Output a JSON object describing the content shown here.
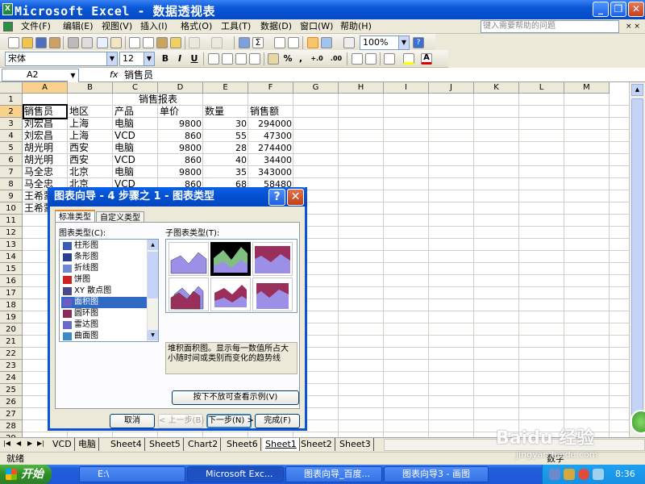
{
  "window": {
    "title": "Microsoft Excel - 数据透视表",
    "minimize": "_",
    "restore": "❐",
    "close": "✕"
  },
  "menu": {
    "items": [
      "文件(F)",
      "编辑(E)",
      "视图(V)",
      "插入(I)",
      "格式(O)",
      "工具(T)",
      "数据(D)",
      "窗口(W)",
      "帮助(H)"
    ],
    "help_placeholder": "键入需要帮助的问题",
    "doc_close": "× ×"
  },
  "toolbar": {
    "zoom": "100%",
    "font": "宋体",
    "font_size": "12",
    "bold": "B",
    "italic": "I",
    "underline": "U",
    "percent": "%",
    "comma": ",",
    "inc_decimal": "+.0",
    "dec_decimal": ".00"
  },
  "formula_bar": {
    "name_box": "A2",
    "fx": "fx",
    "content": "销售员"
  },
  "sheet": {
    "columns": [
      "A",
      "B",
      "C",
      "D",
      "E",
      "F",
      "G",
      "H",
      "I",
      "J",
      "K",
      "L",
      "M"
    ],
    "rows": [
      "1",
      "2",
      "3",
      "4",
      "5",
      "6",
      "7",
      "8",
      "9",
      "10",
      "11",
      "12",
      "13",
      "14",
      "15",
      "16",
      "17",
      "18",
      "19",
      "20",
      "21",
      "22",
      "23",
      "24",
      "25",
      "26",
      "27",
      "28",
      "29"
    ],
    "title_cell": "销售报表",
    "headers": [
      "销售员",
      "地区",
      "产品",
      "单价",
      "数量",
      "销售额"
    ],
    "data": [
      [
        "刘宏昌",
        "上海",
        "电脑",
        "9800",
        "30",
        "294000"
      ],
      [
        "刘宏昌",
        "上海",
        "VCD",
        "860",
        "55",
        "47300"
      ],
      [
        "胡光明",
        "西安",
        "电脑",
        "9800",
        "28",
        "274400"
      ],
      [
        "胡光明",
        "西安",
        "VCD",
        "860",
        "40",
        "34400"
      ],
      [
        "马全忠",
        "北京",
        "电脑",
        "9800",
        "35",
        "343000"
      ],
      [
        "马全忠",
        "北京",
        "VCD",
        "860",
        "68",
        "58480"
      ],
      [
        "王希蒙",
        "",
        "",
        "",
        "",
        ""
      ],
      [
        "王希蒙",
        "",
        "",
        "",
        "",
        ""
      ]
    ]
  },
  "sheet_tabs": [
    "VCD",
    "电脑",
    "Sheet4",
    "Sheet5",
    "Chart2",
    "Sheet6",
    "Sheet1",
    "Sheet2",
    "Sheet3"
  ],
  "active_tab": "Sheet1",
  "status": {
    "left": "就绪",
    "right": "数字"
  },
  "dialog": {
    "title": "图表向导 - 4 步骤之 1 - 图表类型",
    "help": "?",
    "close": "✕",
    "tabs": [
      "标准类型",
      "自定义类型"
    ],
    "chart_type_label": "图表类型(C):",
    "subtype_label": "子图表类型(T):",
    "chart_types": [
      "柱形图",
      "条形图",
      "折线图",
      "饼图",
      "XY 散点图",
      "面积图",
      "圆环图",
      "雷达图",
      "曲面图"
    ],
    "selected_type": "面积图",
    "description": "堆积面积图。显示每一数值所占大小随时间或类别而变化的趋势线",
    "preview_button": "按下不放可查看示例(V)",
    "buttons": {
      "cancel": "取消",
      "back": "< 上一步(B)",
      "next": "下一步(N) >",
      "finish": "完成(F)"
    }
  },
  "taskbar": {
    "start": "开始",
    "tasks": [
      "E:\\",
      "Microsoft Exc...",
      "图表向导_百度...",
      "图表向导3 - 画图"
    ],
    "clock": "8:36"
  },
  "watermark": {
    "brand": "Baidu 经验",
    "url": "jingyan.baidu.com"
  },
  "colors": {
    "title_blue": "#0a58d8",
    "area_purple": "#9b8fe8",
    "area_magenta": "#9b2f5b",
    "area_green": "#7fbf7f"
  }
}
